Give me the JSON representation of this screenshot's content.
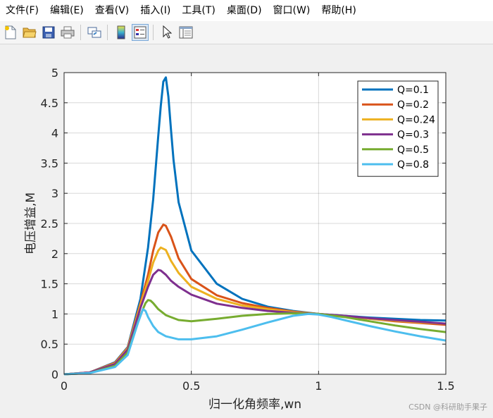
{
  "menu": [
    "文件(F)",
    "编辑(E)",
    "查看(V)",
    "插入(I)",
    "工具(T)",
    "桌面(D)",
    "窗口(W)",
    "帮助(H)"
  ],
  "toolbar": {
    "icons": [
      "new-figure-icon",
      "open-file-icon",
      "save-icon",
      "print-icon",
      "link-plot-icon",
      "insert-colorbar-icon",
      "insert-legend-icon",
      "edit-plot-arrow-icon",
      "property-inspector-icon"
    ]
  },
  "watermark": "CSDN @科研助手果子",
  "chart_data": {
    "type": "line",
    "xlabel": "归一化角频率,wn",
    "ylabel": "电压增益,M",
    "xlim": [
      0,
      1.5
    ],
    "ylim": [
      0,
      5
    ],
    "xticks": [
      "0",
      "0.5",
      "1",
      "1.5"
    ],
    "yticks": [
      "0",
      "0.5",
      "1",
      "1.5",
      "2",
      "2.5",
      "3",
      "3.5",
      "4",
      "4.5",
      "5"
    ],
    "grid": true,
    "legend_position": "top-right",
    "series": [
      {
        "name": "Q=0.1",
        "color": "#0072bd",
        "x": [
          0,
          0.1,
          0.2,
          0.25,
          0.3,
          0.33,
          0.35,
          0.37,
          0.38,
          0.39,
          0.4,
          0.41,
          0.42,
          0.43,
          0.45,
          0.5,
          0.6,
          0.7,
          0.8,
          0.9,
          1.0,
          1.1,
          1.2,
          1.3,
          1.4,
          1.5
        ],
        "y": [
          0,
          0.03,
          0.2,
          0.45,
          1.25,
          2.1,
          2.9,
          3.95,
          4.45,
          4.85,
          4.92,
          4.6,
          4.05,
          3.55,
          2.85,
          2.05,
          1.5,
          1.25,
          1.12,
          1.05,
          1.0,
          0.97,
          0.94,
          0.92,
          0.9,
          0.89
        ]
      },
      {
        "name": "Q=0.2",
        "color": "#d95319",
        "x": [
          0,
          0.1,
          0.2,
          0.25,
          0.3,
          0.33,
          0.35,
          0.37,
          0.39,
          0.4,
          0.42,
          0.45,
          0.5,
          0.6,
          0.7,
          0.8,
          0.9,
          1.0,
          1.1,
          1.2,
          1.3,
          1.4,
          1.5
        ],
        "y": [
          0,
          0.03,
          0.19,
          0.44,
          1.18,
          1.65,
          2.05,
          2.35,
          2.48,
          2.46,
          2.28,
          1.92,
          1.58,
          1.31,
          1.18,
          1.1,
          1.04,
          1.0,
          0.96,
          0.92,
          0.88,
          0.85,
          0.82
        ]
      },
      {
        "name": "Q=0.24",
        "color": "#edb120",
        "x": [
          0,
          0.1,
          0.2,
          0.25,
          0.3,
          0.33,
          0.35,
          0.37,
          0.38,
          0.4,
          0.42,
          0.45,
          0.5,
          0.6,
          0.7,
          0.8,
          0.9,
          1.0,
          1.1,
          1.2,
          1.3,
          1.4,
          1.5
        ],
        "y": [
          0,
          0.03,
          0.18,
          0.43,
          1.15,
          1.55,
          1.85,
          2.05,
          2.1,
          2.06,
          1.88,
          1.68,
          1.45,
          1.25,
          1.14,
          1.08,
          1.03,
          1.0,
          0.96,
          0.92,
          0.89,
          0.86,
          0.84
        ]
      },
      {
        "name": "Q=0.3",
        "color": "#7e2f8e",
        "x": [
          0,
          0.1,
          0.2,
          0.25,
          0.3,
          0.33,
          0.35,
          0.37,
          0.38,
          0.4,
          0.42,
          0.45,
          0.5,
          0.6,
          0.7,
          0.8,
          0.9,
          1.0,
          1.1,
          1.2,
          1.3,
          1.4,
          1.5
        ],
        "y": [
          0,
          0.03,
          0.17,
          0.41,
          1.1,
          1.45,
          1.65,
          1.73,
          1.72,
          1.65,
          1.55,
          1.45,
          1.32,
          1.17,
          1.1,
          1.05,
          1.02,
          1.0,
          0.97,
          0.93,
          0.9,
          0.87,
          0.84
        ]
      },
      {
        "name": "Q=0.5",
        "color": "#77ac30",
        "x": [
          0,
          0.1,
          0.2,
          0.25,
          0.3,
          0.32,
          0.33,
          0.34,
          0.35,
          0.37,
          0.4,
          0.45,
          0.5,
          0.6,
          0.7,
          0.8,
          0.9,
          1.0,
          1.1,
          1.2,
          1.3,
          1.4,
          1.5
        ],
        "y": [
          0,
          0.02,
          0.14,
          0.36,
          0.98,
          1.18,
          1.23,
          1.22,
          1.18,
          1.08,
          0.98,
          0.9,
          0.88,
          0.92,
          0.97,
          1.0,
          1.01,
          1.0,
          0.95,
          0.88,
          0.81,
          0.75,
          0.7
        ]
      },
      {
        "name": "Q=0.8",
        "color": "#4dbeee",
        "x": [
          0,
          0.1,
          0.2,
          0.25,
          0.29,
          0.31,
          0.32,
          0.33,
          0.35,
          0.37,
          0.4,
          0.45,
          0.5,
          0.6,
          0.7,
          0.8,
          0.9,
          0.96,
          1.0,
          1.05,
          1.1,
          1.2,
          1.3,
          1.4,
          1.5
        ],
        "y": [
          0,
          0.02,
          0.12,
          0.32,
          0.85,
          1.08,
          1.05,
          0.95,
          0.8,
          0.7,
          0.63,
          0.58,
          0.58,
          0.63,
          0.74,
          0.86,
          0.97,
          1.0,
          0.99,
          0.95,
          0.9,
          0.8,
          0.71,
          0.63,
          0.56
        ]
      }
    ]
  }
}
